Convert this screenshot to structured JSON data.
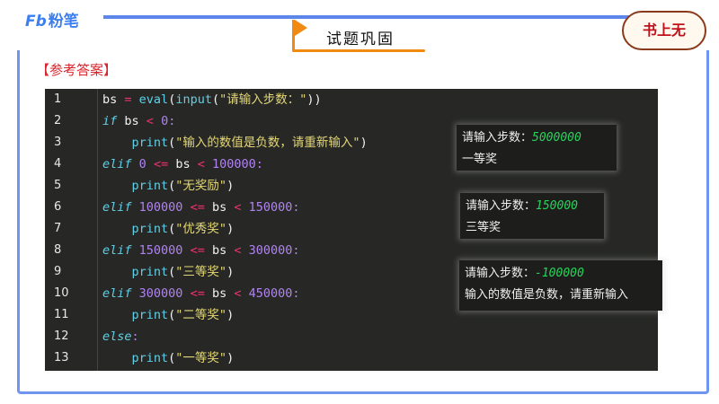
{
  "header": {
    "logo_mark": "Fb",
    "logo_text": "粉笔",
    "title": "试题巩固",
    "badge": "书上无"
  },
  "answer_label": "【参考答案】",
  "code_lines": [
    {
      "n": "1",
      "tokens": [
        [
          "bs ",
          "plain"
        ],
        [
          "=",
          "op"
        ],
        [
          " ",
          "plain"
        ],
        [
          "eval",
          "fn"
        ],
        [
          "(",
          "plain"
        ],
        [
          "input",
          "fn"
        ],
        [
          "(",
          "plain"
        ],
        [
          "\"请输入步数：\"",
          "str"
        ],
        [
          "))",
          "plain"
        ]
      ]
    },
    {
      "n": "2",
      "tokens": [
        [
          "if",
          "kw"
        ],
        [
          " bs ",
          "plain"
        ],
        [
          "<",
          "op"
        ],
        [
          " ",
          "plain"
        ],
        [
          "0",
          "num"
        ],
        [
          ":",
          "colon"
        ]
      ]
    },
    {
      "n": "3",
      "tokens": [
        [
          "    ",
          "plain"
        ],
        [
          "print",
          "fn"
        ],
        [
          "(",
          "plain"
        ],
        [
          "\"输入的数值是负数，请重新输入\"",
          "str"
        ],
        [
          ")",
          "plain"
        ]
      ]
    },
    {
      "n": "4",
      "tokens": [
        [
          "elif",
          "kw"
        ],
        [
          " ",
          "plain"
        ],
        [
          "0",
          "num"
        ],
        [
          " ",
          "plain"
        ],
        [
          "<=",
          "op"
        ],
        [
          " bs ",
          "plain"
        ],
        [
          "<",
          "op"
        ],
        [
          " ",
          "plain"
        ],
        [
          "100000",
          "num"
        ],
        [
          ":",
          "colon"
        ]
      ]
    },
    {
      "n": "5",
      "tokens": [
        [
          "    ",
          "plain"
        ],
        [
          "print",
          "fn"
        ],
        [
          "(",
          "plain"
        ],
        [
          "\"无奖励\"",
          "str"
        ],
        [
          ")",
          "plain"
        ]
      ]
    },
    {
      "n": "6",
      "tokens": [
        [
          "elif",
          "kw"
        ],
        [
          " ",
          "plain"
        ],
        [
          "100000",
          "num"
        ],
        [
          " ",
          "plain"
        ],
        [
          "<=",
          "op"
        ],
        [
          " bs ",
          "plain"
        ],
        [
          "<",
          "op"
        ],
        [
          " ",
          "plain"
        ],
        [
          "150000",
          "num"
        ],
        [
          ":",
          "colon"
        ]
      ]
    },
    {
      "n": "7",
      "tokens": [
        [
          "    ",
          "plain"
        ],
        [
          "print",
          "fn"
        ],
        [
          "(",
          "plain"
        ],
        [
          "\"优秀奖\"",
          "str"
        ],
        [
          ")",
          "plain"
        ]
      ]
    },
    {
      "n": "8",
      "tokens": [
        [
          "elif",
          "kw"
        ],
        [
          " ",
          "plain"
        ],
        [
          "150000",
          "num"
        ],
        [
          " ",
          "plain"
        ],
        [
          "<=",
          "op"
        ],
        [
          " bs ",
          "plain"
        ],
        [
          "<",
          "op"
        ],
        [
          " ",
          "plain"
        ],
        [
          "300000",
          "num"
        ],
        [
          ":",
          "colon"
        ]
      ]
    },
    {
      "n": "9",
      "tokens": [
        [
          "    ",
          "plain"
        ],
        [
          "print",
          "fn"
        ],
        [
          "(",
          "plain"
        ],
        [
          "\"三等奖\"",
          "str"
        ],
        [
          ")",
          "plain"
        ]
      ]
    },
    {
      "n": "10",
      "tokens": [
        [
          "elif",
          "kw"
        ],
        [
          " ",
          "plain"
        ],
        [
          "300000",
          "num"
        ],
        [
          " ",
          "plain"
        ],
        [
          "<=",
          "op"
        ],
        [
          " bs ",
          "plain"
        ],
        [
          "<",
          "op"
        ],
        [
          " ",
          "plain"
        ],
        [
          "450000",
          "num"
        ],
        [
          ":",
          "colon"
        ]
      ]
    },
    {
      "n": "11",
      "tokens": [
        [
          "    ",
          "plain"
        ],
        [
          "print",
          "fn"
        ],
        [
          "(",
          "plain"
        ],
        [
          "\"二等奖\"",
          "str"
        ],
        [
          ")",
          "plain"
        ]
      ]
    },
    {
      "n": "12",
      "tokens": [
        [
          "else",
          "kw"
        ],
        [
          ":",
          "colon"
        ]
      ]
    },
    {
      "n": "13",
      "tokens": [
        [
          "    ",
          "plain"
        ],
        [
          "print",
          "fn"
        ],
        [
          "(",
          "plain"
        ],
        [
          "\"一等奖\"",
          "str"
        ],
        [
          ")",
          "plain"
        ]
      ]
    }
  ],
  "outputs": [
    {
      "prompt": "请输入步数：",
      "value": "5000000",
      "result": "一等奖"
    },
    {
      "prompt": "请输入步数：",
      "value": "150000",
      "result": "三等奖"
    },
    {
      "prompt": "请输入步数：",
      "value": "-100000",
      "result": "输入的数值是负数，请重新输入"
    }
  ]
}
